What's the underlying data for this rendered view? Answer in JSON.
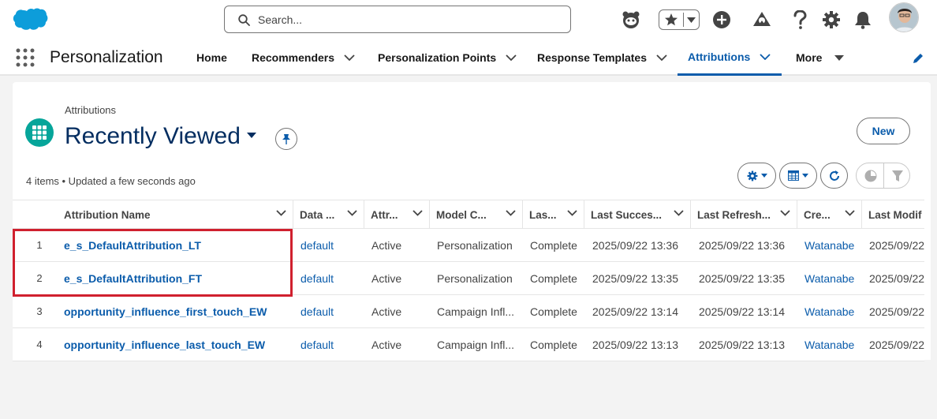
{
  "header": {
    "search_placeholder": "Search...",
    "icons": [
      "salesforce-logo",
      "astro-icon",
      "favorites-star-icon",
      "add-icon",
      "trailhead-icon",
      "help-icon",
      "setup-gear-icon",
      "notifications-bell-icon",
      "user-avatar"
    ]
  },
  "nav": {
    "app_name": "Personalization",
    "items": [
      {
        "label": "Home",
        "has_menu": false,
        "active": false
      },
      {
        "label": "Recommenders",
        "has_menu": true,
        "active": false
      },
      {
        "label": "Personalization Points",
        "has_menu": true,
        "active": false
      },
      {
        "label": "Response Templates",
        "has_menu": true,
        "active": false
      },
      {
        "label": "Attributions",
        "has_menu": true,
        "active": true
      },
      {
        "label": "More",
        "has_menu": true,
        "active": false
      }
    ]
  },
  "list_view": {
    "object_label": "Attributions",
    "title": "Recently Viewed",
    "new_button": "New",
    "meta": "4 items • Updated a few seconds ago",
    "columns": [
      "Attribution Name",
      "Data ...",
      "Attr...",
      "Model C...",
      "Las...",
      "Last Succes...",
      "Last Refresh...",
      "Cre...",
      "Last Modif"
    ],
    "rows": [
      {
        "num": "1",
        "name": "e_s_DefaultAttribution_LT",
        "data": "default",
        "attr": "Active",
        "model": "Personalization",
        "last": "Complete",
        "success": "2025/09/22 13:36",
        "refresh": "2025/09/22 13:36",
        "created": "Watanabe",
        "modified": "2025/09/22"
      },
      {
        "num": "2",
        "name": "e_s_DefaultAttribution_FT",
        "data": "default",
        "attr": "Active",
        "model": "Personalization",
        "last": "Complete",
        "success": "2025/09/22 13:35",
        "refresh": "2025/09/22 13:35",
        "created": "Watanabe",
        "modified": "2025/09/22"
      },
      {
        "num": "3",
        "name": "opportunity_influence_first_touch_EW",
        "data": "default",
        "attr": "Active",
        "model": "Campaign Infl...",
        "last": "Complete",
        "success": "2025/09/22 13:14",
        "refresh": "2025/09/22 13:14",
        "created": "Watanabe",
        "modified": "2025/09/22"
      },
      {
        "num": "4",
        "name": "opportunity_influence_last_touch_EW",
        "data": "default",
        "attr": "Active",
        "model": "Campaign Infl...",
        "last": "Complete",
        "success": "2025/09/22 13:13",
        "refresh": "2025/09/22 13:13",
        "created": "Watanabe",
        "modified": "2025/09/22"
      }
    ]
  },
  "colors": {
    "brand_blue": "#0b5cab",
    "title_navy": "#032d60",
    "object_icon_teal": "#06a59a",
    "highlight_red": "#d0202e"
  }
}
